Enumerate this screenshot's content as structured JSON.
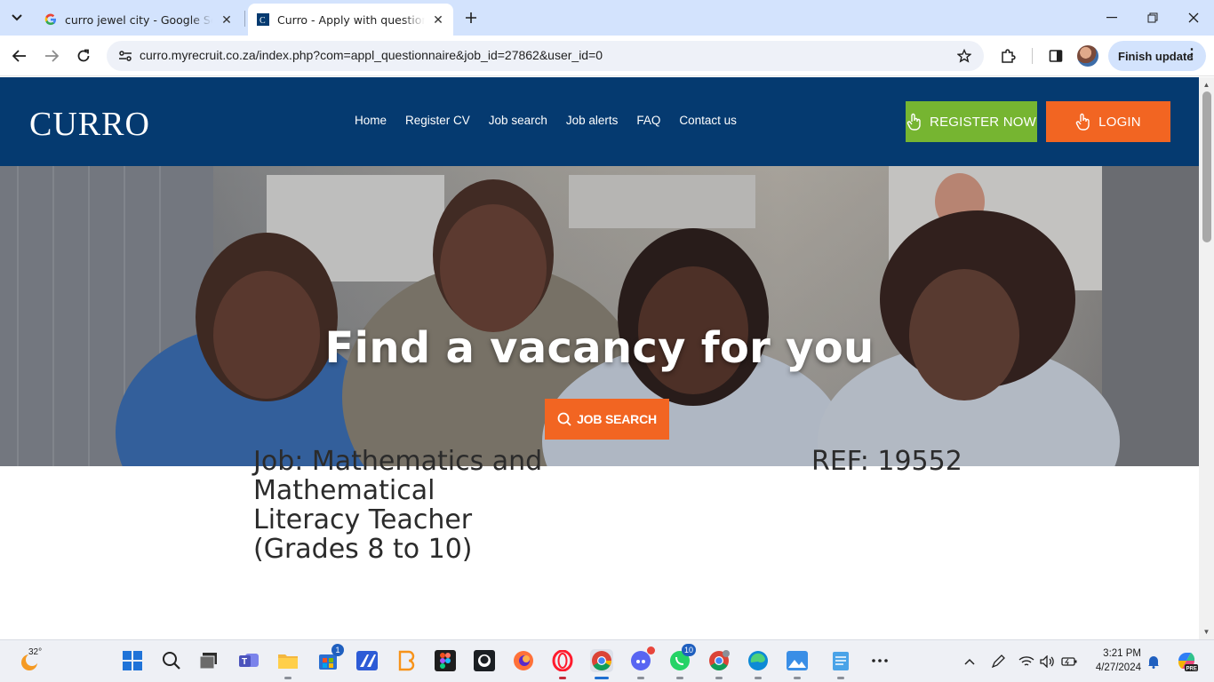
{
  "browser": {
    "tabs": [
      {
        "title": "curro jewel city - Google Search",
        "favicon": "google-icon",
        "active": false
      },
      {
        "title": "Curro - Apply with questionnaire",
        "favicon": "curro-favicon-icon",
        "active": true
      }
    ],
    "url": "curro.myrecruit.co.za/index.php?com=appl_questionnaire&job_id=27862&user_id=0",
    "finish_update_label": "Finish update"
  },
  "site": {
    "logo_text": "CURRO",
    "nav": [
      "Home",
      "Register CV",
      "Job search",
      "Job alerts",
      "FAQ",
      "Contact us"
    ],
    "register_label": "REGISTER NOW",
    "login_label": "LOGIN",
    "colors": {
      "header_bg": "#053a70",
      "register_bg": "#76b531",
      "login_bg": "#f26522"
    }
  },
  "hero": {
    "title": "Find a vacancy for you",
    "search_button_label": "JOB SEARCH",
    "image_label": "students-and-teacher-photo"
  },
  "job": {
    "title": "Job: Mathematics and Mathematical Literacy Teacher (Grades 8 to 10)",
    "ref": "REF: 19552"
  },
  "taskbar": {
    "weather_temp": "32°",
    "store_badge": "1",
    "discord_badge": "",
    "whatsapp_badge": "10",
    "time": "3:21 PM",
    "date": "4/27/2024",
    "apps": [
      "start-icon",
      "search-icon",
      "task-view-icon",
      "teams-icon",
      "file-explorer-icon",
      "microsoft-store-icon",
      "app-icon",
      "bitcoin-wallet-icon",
      "figma-icon",
      "github-icon",
      "firefox-icon",
      "opera-icon",
      "chrome-icon",
      "discord-icon",
      "whatsapp-icon",
      "chrome-profile-icon",
      "edge-icon",
      "photos-icon",
      "notepad-icon",
      "more-apps-icon"
    ]
  }
}
